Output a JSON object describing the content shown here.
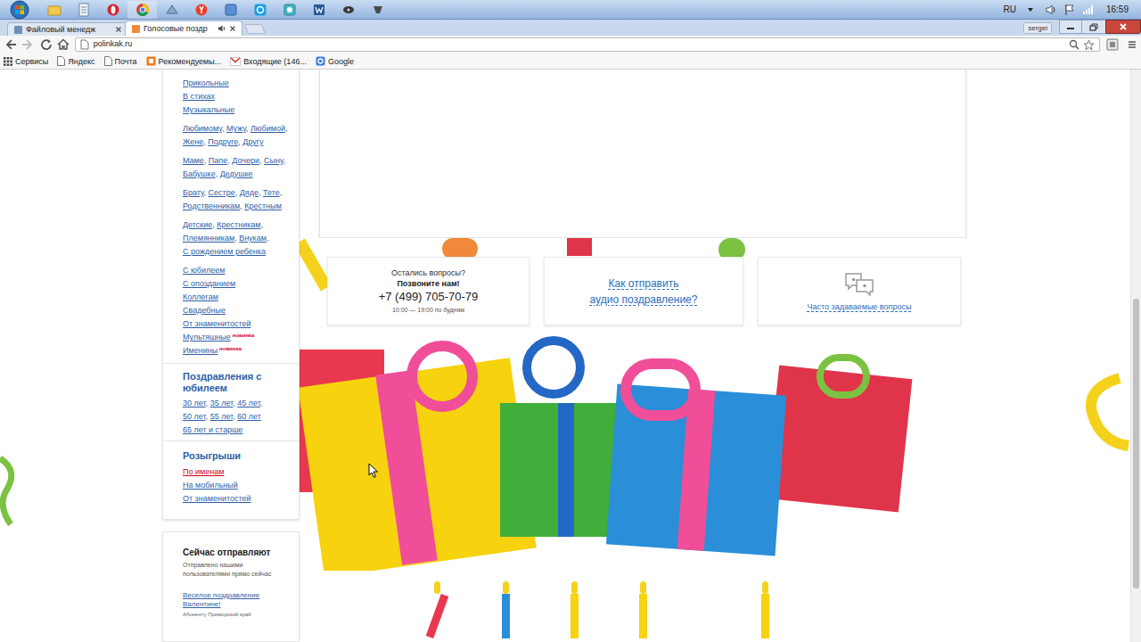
{
  "taskbar": {
    "language": "RU",
    "clock": "16:59"
  },
  "browser": {
    "tabs": [
      {
        "title": "Файловый менедж",
        "selected": false,
        "audio": false
      },
      {
        "title": "Голосовые поздр",
        "selected": true,
        "audio": true
      }
    ],
    "profile": "sergei",
    "address": "polinkak.ru",
    "bookmarks": [
      "Сервисы",
      "Яндекс",
      "Почта",
      "Рекомендуемы...",
      "Входящие (146...",
      "Google"
    ]
  },
  "sidebar": {
    "groups": [
      {
        "lines": [
          [
            {
              "text": "Прикольные"
            }
          ],
          [
            {
              "text": "В стихах"
            }
          ],
          [
            {
              "text": "Музыкальные"
            }
          ]
        ]
      },
      {
        "lines": [
          [
            {
              "text": "Любимому",
              "sep": ","
            },
            {
              "text": "Мужу",
              "sep": ","
            },
            {
              "text": "Любимой",
              "sep": ","
            }
          ],
          [
            {
              "text": "Жене",
              "sep": ","
            },
            {
              "text": "Подруге",
              "sep": ","
            },
            {
              "text": "Другу"
            }
          ]
        ]
      },
      {
        "lines": [
          [
            {
              "text": "Маме",
              "sep": ","
            },
            {
              "text": "Папе",
              "sep": ","
            },
            {
              "text": "Дочери",
              "sep": ","
            },
            {
              "text": "Сыну",
              "sep": ","
            }
          ],
          [
            {
              "text": "Бабушке",
              "sep": ","
            },
            {
              "text": "Дедушке"
            }
          ]
        ]
      },
      {
        "lines": [
          [
            {
              "text": "Брату",
              "sep": ","
            },
            {
              "text": "Сестре",
              "sep": ","
            },
            {
              "text": "Дяде",
              "sep": ","
            },
            {
              "text": "Тете",
              "sep": ","
            }
          ],
          [
            {
              "text": "Родственникам",
              "sep": ","
            },
            {
              "text": "Крестным"
            }
          ]
        ]
      },
      {
        "lines": [
          [
            {
              "text": "Детские",
              "sep": ","
            },
            {
              "text": "Крестникам",
              "sep": ","
            }
          ],
          [
            {
              "text": "Племянникам",
              "sep": ","
            },
            {
              "text": "Внукам",
              "sep": ","
            }
          ],
          [
            {
              "text": "С рождением ребенка"
            }
          ]
        ]
      },
      {
        "lines": [
          [
            {
              "text": "С юбилеем"
            }
          ],
          [
            {
              "text": "С опозданием"
            }
          ],
          [
            {
              "text": "Коллегам"
            }
          ],
          [
            {
              "text": "Свадебные"
            }
          ],
          [
            {
              "text": "От знаменитостей"
            }
          ],
          [
            {
              "text": "Мультяшные",
              "badge": "новинка"
            }
          ],
          [
            {
              "text": "Именины",
              "badge": "новинка"
            }
          ]
        ]
      }
    ],
    "sections": [
      {
        "title": "Поздравления с юбилеем",
        "lines": [
          [
            {
              "text": "30 лет",
              "sep": ","
            },
            {
              "text": "35 лет",
              "sep": ","
            },
            {
              "text": "45 лет",
              "sep": ","
            }
          ],
          [
            {
              "text": "50 лет",
              "sep": ","
            },
            {
              "text": "55 лет",
              "sep": ","
            },
            {
              "text": "60 лет"
            }
          ],
          [
            {
              "text": "65 лет и старше"
            }
          ]
        ]
      },
      {
        "title": "Розыгрыши",
        "lines": [
          [
            {
              "text": "По именам",
              "highlighted": true
            }
          ],
          [
            {
              "text": "На мобильный",
              "highlighted": false
            }
          ],
          [
            {
              "text": "От знаменитостей",
              "highlighted": false
            }
          ]
        ]
      }
    ],
    "now_sending": {
      "title": "Сейчас отправляют",
      "subtitle": "Отправлено нашими пользователями прямо сейчас",
      "items": [
        {
          "link": "Веселое поздравление Валентине!",
          "region": "Абоненту Приморский край"
        }
      ]
    }
  },
  "cards": {
    "call": {
      "question": "Остались вопросы?",
      "prompt": "Позвоните нам!",
      "phone": "+7 (499) 705-70-79",
      "hours": "10:00 — 19:00 по будням"
    },
    "howto": {
      "lines": [
        "Как отправить",
        "аудио поздравление?"
      ]
    },
    "faq": {
      "label": "Часто задаваемые вопросы"
    }
  }
}
